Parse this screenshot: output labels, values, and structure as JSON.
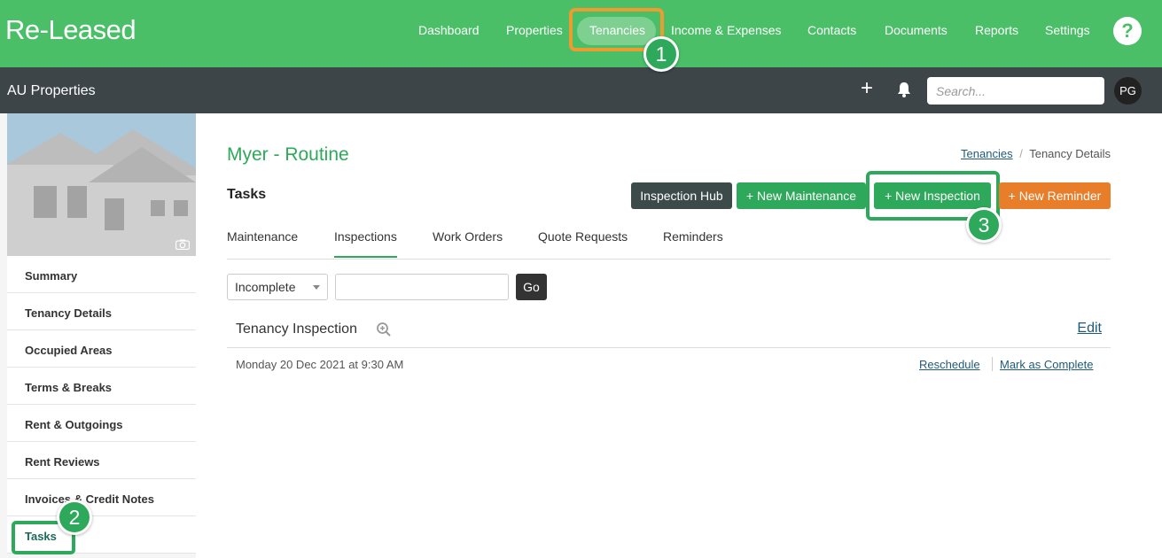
{
  "app": {
    "logo": "Re-Leased"
  },
  "nav": {
    "items": [
      "Dashboard",
      "Properties",
      "Tenancies",
      "Income & Expenses",
      "Contacts",
      "Documents",
      "Reports",
      "Settings"
    ],
    "help": "?"
  },
  "badges": {
    "one": "1",
    "two": "2",
    "three": "3"
  },
  "subbar": {
    "org": "AU Properties",
    "search_placeholder": "Search...",
    "avatar": "PG"
  },
  "sidebar": {
    "items": [
      "Summary",
      "Tenancy Details",
      "Occupied Areas",
      "Terms & Breaks",
      "Rent & Outgoings",
      "Rent Reviews",
      "Invoices & Credit Notes",
      "Tasks"
    ]
  },
  "main": {
    "title": "Myer - Routine",
    "breadcrumb": {
      "link": "Tenancies",
      "sep": "/",
      "current": "Tenancy Details"
    },
    "section": "Tasks",
    "buttons": {
      "hub": "Inspection Hub",
      "maintenance": "+ New Maintenance",
      "inspection": "+ New Inspection",
      "reminder": "+ New Reminder"
    },
    "tabs": [
      "Maintenance",
      "Inspections",
      "Work Orders",
      "Quote Requests",
      "Reminders"
    ],
    "filter": {
      "status": "Incomplete",
      "go": "Go"
    },
    "inspection": {
      "name": "Tenancy Inspection",
      "edit": "Edit",
      "date": "Monday 20 Dec 2021 at 9:30 AM",
      "reschedule": "Reschedule",
      "complete": "Mark as Complete"
    }
  },
  "colors": {
    "brand_green": "#4abf68",
    "dark_bar": "#3d4549",
    "accent_orange": "#e87d2a",
    "badge_green": "#2ea85a"
  }
}
